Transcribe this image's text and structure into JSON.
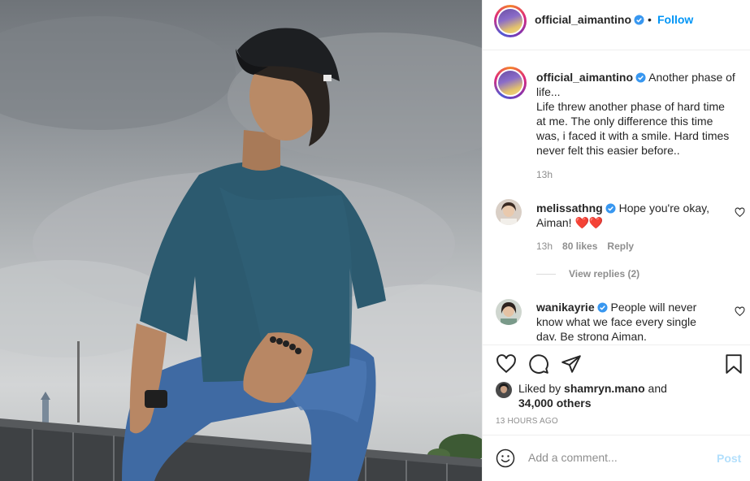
{
  "post": {
    "username": "official_aimantino",
    "follow_label": "Follow",
    "separator": "•",
    "caption_first": "Another phase of",
    "caption_lines": [
      "life...",
      "Life threw another phase of hard time",
      "at me. The only difference this time",
      "was, i faced it with a smile. Hard times",
      "never felt this easier before.."
    ],
    "caption_time": "13h"
  },
  "comments": [
    {
      "username": "melissathng",
      "text_first": "Hope you're okay,",
      "text_second": "Aiman!",
      "emoji": "❤️❤️",
      "time": "13h",
      "likes": "80 likes",
      "reply_label": "Reply",
      "view_replies": "View replies (2)"
    },
    {
      "username": "wanikayrie",
      "text_first": "People will never",
      "text_second": "know what we face every single",
      "text_third": "day. Be strong Aiman."
    }
  ],
  "likes": {
    "prefix": "Liked by",
    "user": "shamryn.mano",
    "suffix": "and",
    "count": "34,000 others"
  },
  "timestamp": "13 HOURS AGO",
  "composer": {
    "placeholder": "Add a comment...",
    "post_label": "Post"
  },
  "colors": {
    "link_blue": "#0095f6",
    "post_disabled": "#b2dffc",
    "verified_blue": "#3897f0",
    "heart_red": "#ed4956"
  },
  "icons": [
    "verified-icon",
    "heart-icon",
    "comment-icon",
    "share-icon",
    "bookmark-icon",
    "emoji-icon"
  ]
}
